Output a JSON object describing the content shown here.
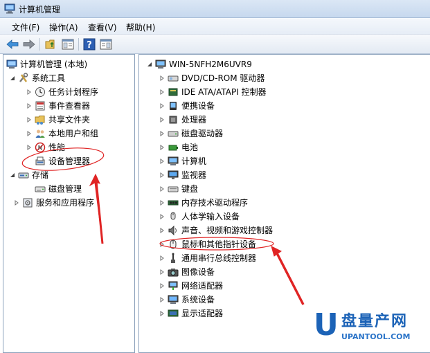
{
  "window": {
    "title": "计算机管理"
  },
  "menu": [
    "文件(F)",
    "操作(A)",
    "查看(V)",
    "帮助(H)"
  ],
  "left_tree": [
    {
      "label": "计算机管理 (本地)",
      "icon": "computer-management-icon",
      "expander": "expanded-root"
    },
    {
      "label": "系统工具",
      "icon": "system-tools-icon",
      "expander": "expanded"
    },
    {
      "label": "任务计划程序",
      "icon": "clock-icon",
      "expander": "collapsed"
    },
    {
      "label": "事件查看器",
      "icon": "event-viewer-icon",
      "expander": "collapsed"
    },
    {
      "label": "共享文件夹",
      "icon": "shared-folder-icon",
      "expander": "collapsed"
    },
    {
      "label": "本地用户和组",
      "icon": "users-icon",
      "expander": "collapsed"
    },
    {
      "label": "性能",
      "icon": "performance-icon",
      "expander": "collapsed"
    },
    {
      "label": "设备管理器",
      "icon": "device-manager-icon",
      "expander": "none"
    },
    {
      "label": "存储",
      "icon": "storage-icon",
      "expander": "expanded"
    },
    {
      "label": "磁盘管理",
      "icon": "disk-management-icon",
      "expander": "none"
    },
    {
      "label": "服务和应用程序",
      "icon": "services-icon",
      "expander": "collapsed"
    }
  ],
  "right_tree": {
    "root": "WIN-5NFH2M6UVR9",
    "items": [
      {
        "label": "DVD/CD-ROM 驱动器",
        "icon": "dvd-drive-icon"
      },
      {
        "label": "IDE ATA/ATAPI 控制器",
        "icon": "ide-controller-icon"
      },
      {
        "label": "便携设备",
        "icon": "portable-device-icon"
      },
      {
        "label": "处理器",
        "icon": "processor-icon"
      },
      {
        "label": "磁盘驱动器",
        "icon": "disk-drive-icon"
      },
      {
        "label": "电池",
        "icon": "battery-icon"
      },
      {
        "label": "计算机",
        "icon": "computer-icon"
      },
      {
        "label": "监视器",
        "icon": "monitor-icon"
      },
      {
        "label": "键盘",
        "icon": "keyboard-icon"
      },
      {
        "label": "内存技术驱动程序",
        "icon": "memory-driver-icon"
      },
      {
        "label": "人体学输入设备",
        "icon": "hid-icon"
      },
      {
        "label": "声音、视频和游戏控制器",
        "icon": "sound-icon"
      },
      {
        "label": "鼠标和其他指针设备",
        "icon": "mouse-icon"
      },
      {
        "label": "通用串行总线控制器",
        "icon": "usb-icon"
      },
      {
        "label": "图像设备",
        "icon": "imaging-device-icon"
      },
      {
        "label": "网络适配器",
        "icon": "network-adapter-icon"
      },
      {
        "label": "系统设备",
        "icon": "system-device-icon"
      },
      {
        "label": "显示适配器",
        "icon": "display-adapter-icon"
      }
    ]
  },
  "watermark": {
    "letter": "U",
    "brand": "盘量产网",
    "url": "UPANTOOL.COM"
  },
  "colors": {
    "annotation": "#e02424",
    "watermark": "#1c63b7"
  }
}
